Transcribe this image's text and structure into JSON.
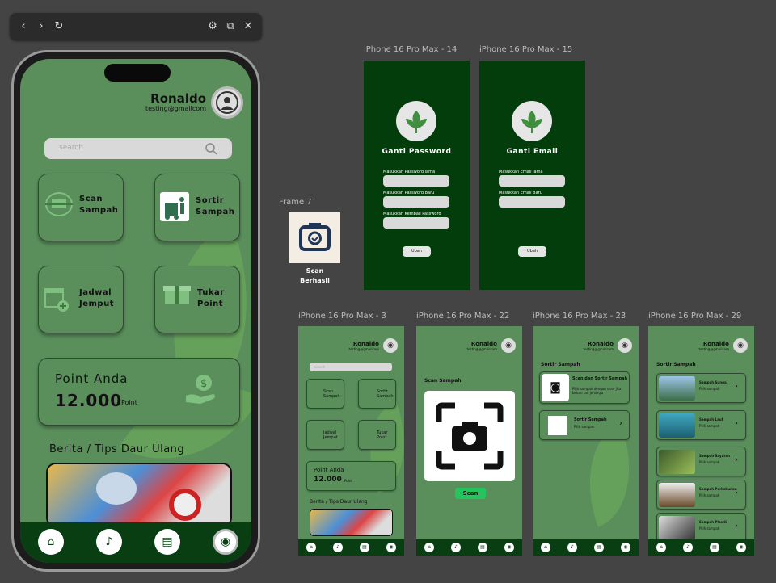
{
  "toolbar": {
    "back": "‹",
    "forward": "›",
    "reload": "↻",
    "settings": "⚙",
    "external": "⧉",
    "close": "✕"
  },
  "phone": {
    "user_name": "Ronaldo",
    "user_email": "testing@gmailcom",
    "search_placeholder": "search",
    "cards": [
      {
        "label": "Scan\nSampah",
        "icon": "scan-icon"
      },
      {
        "label": "Sortir\nSampah",
        "icon": "trash-bin-icon"
      },
      {
        "label": "Jadwal\nJemput",
        "icon": "calendar-icon"
      },
      {
        "label": "Tukar\nPoint",
        "icon": "gift-icon"
      }
    ],
    "point_title": "Point Anda",
    "point_value": "12.000",
    "point_unit": "Point",
    "news_title": "Berita / Tips Daur Ulang"
  },
  "frames": {
    "f14": {
      "label": "iPhone 16 Pro Max - 14",
      "title": "Ganti Password",
      "fields": [
        "Masukkan Password lama",
        "Masukkan Password Baru",
        "Masukkan Kembali Password"
      ],
      "button": "Ubah"
    },
    "f15": {
      "label": "iPhone 16 Pro Max - 15",
      "title": "Ganti Email",
      "fields": [
        "Masukkan Email lama",
        "Masukkan Email Baru"
      ],
      "button": "Ubah"
    },
    "f7": {
      "label": "Frame 7",
      "caption": "Scan\nBerhasil"
    },
    "f3": {
      "label": "iPhone 16 Pro Max - 3",
      "name": "Ronaldo",
      "email": "testing@gmailcom",
      "search": "search",
      "cards": [
        "Scan\nSampah",
        "Sortir\nSampah",
        "Jadwal\nJemput",
        "Tukar\nPoint"
      ],
      "point_title": "Point Anda",
      "point_value": "12.000",
      "point_unit": "Point",
      "news_title": "Berita / Tips Daur Ulang"
    },
    "f22": {
      "label": "iPhone 16 Pro Max - 22",
      "name": "Ronaldo",
      "email": "testing@gmailcom",
      "section": "Scan Sampah",
      "button": "Scan"
    },
    "f23": {
      "label": "iPhone 16 Pro Max - 23",
      "name": "Ronaldo",
      "email": "testing@gmailcom",
      "section": "Sortir Sampah",
      "items": [
        {
          "title": "Scan dan Sortir Sampah",
          "desc": "Pilih sampah dengan scan jika belum tau jenisnya"
        },
        {
          "title": "Sortir Sampah",
          "desc": "Pilih sampah"
        }
      ]
    },
    "f29": {
      "label": "iPhone 16 Pro Max - 29",
      "name": "Ronaldo",
      "email": "testing@gmailcom",
      "section": "Sortir Sampah",
      "items": [
        {
          "title": "Sampah Sungai",
          "desc": "Pilih sampah"
        },
        {
          "title": "Sampah Laut",
          "desc": "Pilih sampah"
        },
        {
          "title": "Sampah Sayuran",
          "desc": "Pilih sampah"
        },
        {
          "title": "Sampah Perkebunan",
          "desc": "Pilih sampah"
        },
        {
          "title": "Sampah Plastik",
          "desc": "Pilih sampah"
        }
      ]
    }
  },
  "colors": {
    "canvas": "#444444",
    "green": "#5a8f5c",
    "dark_green": "#033d0b",
    "nav": "#093d12",
    "accent": "#22c55e"
  }
}
